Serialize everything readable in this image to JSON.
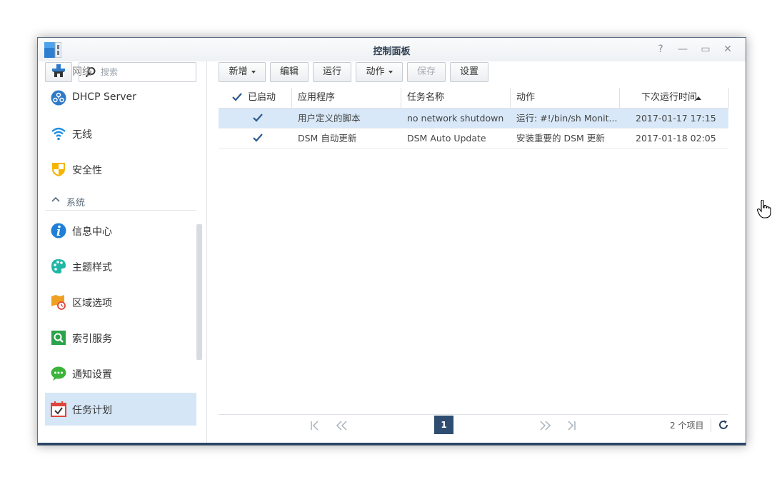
{
  "window": {
    "title": "控制面板",
    "controls": [
      "?",
      "—",
      "▭",
      "✕"
    ]
  },
  "sidebar": {
    "search_placeholder": "搜索",
    "partial_item_label": "网络",
    "items_top": [
      {
        "label": "DHCP Server",
        "icon": "dhcp-server-icon"
      },
      {
        "label": "无线",
        "icon": "wifi-icon"
      },
      {
        "label": "安全性",
        "icon": "shield-icon"
      }
    ],
    "section": {
      "label": "系统",
      "icon": "chevron-up-icon"
    },
    "items_system": [
      {
        "label": "信息中心",
        "icon": "info-icon"
      },
      {
        "label": "主题样式",
        "icon": "palette-icon"
      },
      {
        "label": "区域选项",
        "icon": "regional-options-icon"
      },
      {
        "label": "索引服务",
        "icon": "index-search-icon"
      },
      {
        "label": "通知设置",
        "icon": "chat-bubble-icon"
      },
      {
        "label": "任务计划",
        "icon": "calendar-check-icon",
        "active": true
      }
    ]
  },
  "toolbar": {
    "create": "新增",
    "edit": "编辑",
    "run": "运行",
    "action": "动作",
    "save": "保存",
    "settings": "设置"
  },
  "table": {
    "columns": {
      "enabled": "已启动",
      "app": "应用程序",
      "task": "任务名称",
      "action": "动作",
      "next_run": "下次运行时间"
    },
    "rows": [
      {
        "enabled": true,
        "app": "用户定义的脚本",
        "task": "no network shutdown",
        "action": "运行: #!/bin/sh Monit...",
        "next_run": "2017-01-17 17:15",
        "selected": true
      },
      {
        "enabled": true,
        "app": "DSM 自动更新",
        "task": "DSM Auto Update",
        "action": "安装重要的 DSM 更新",
        "next_run": "2017-01-18 02:05",
        "selected": false
      }
    ]
  },
  "pager": {
    "current_page": "1",
    "count_label": "2 个项目"
  },
  "colors": {
    "accent": "#2f4d70",
    "selection": "#d8e8f8",
    "active_nav": "#d5e6f7"
  }
}
